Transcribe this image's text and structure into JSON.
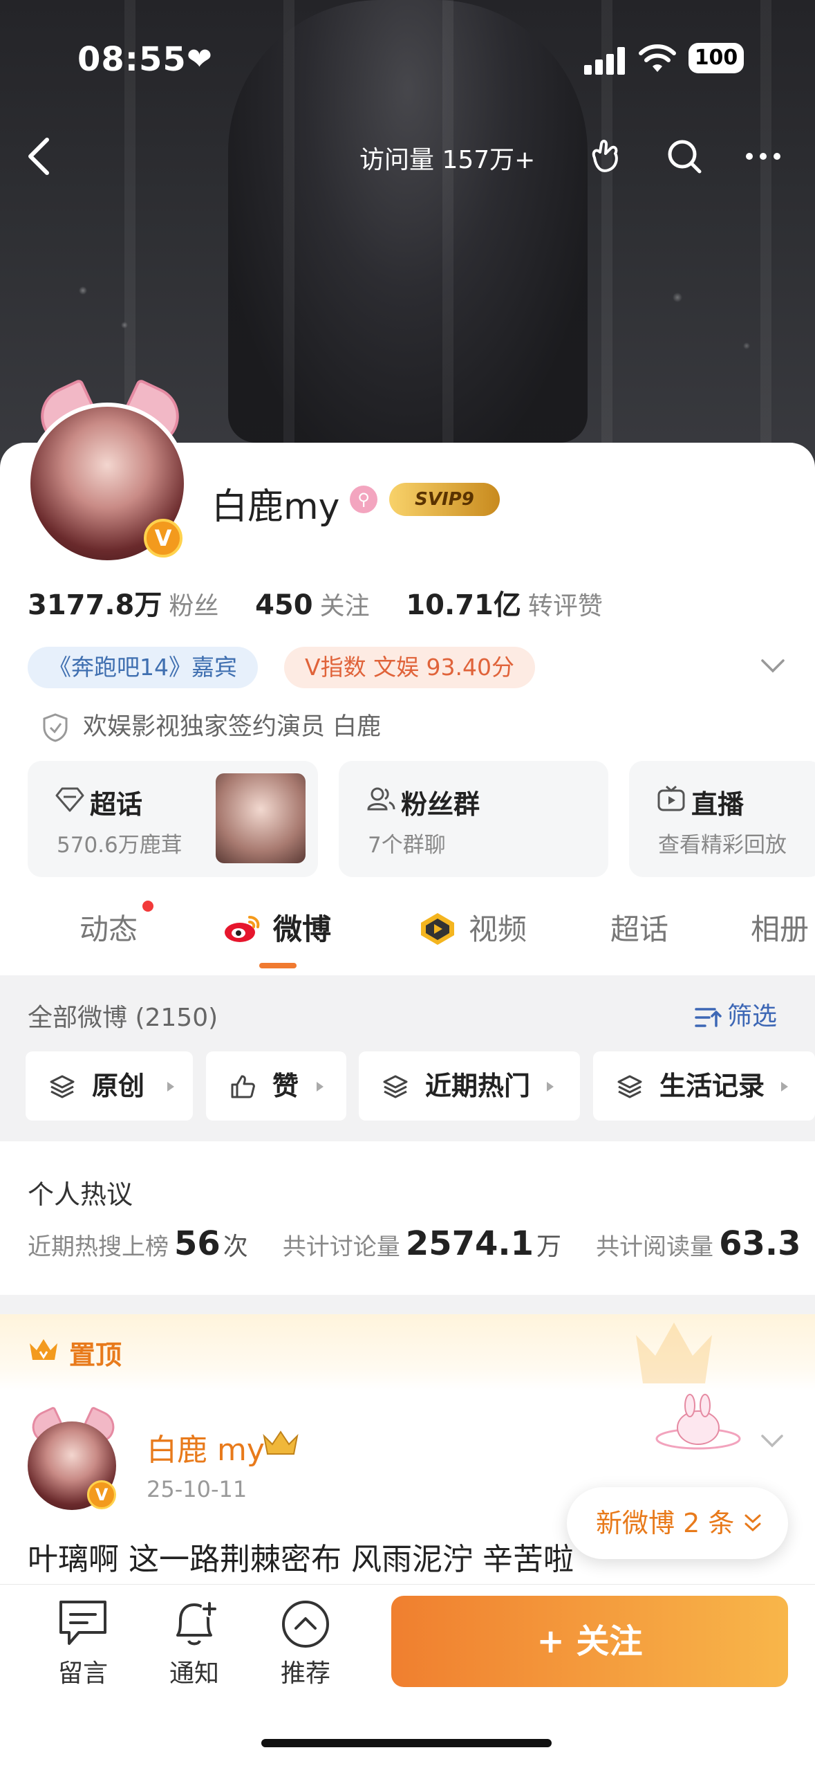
{
  "status_bar": {
    "time": "08:55",
    "battery": "100"
  },
  "nav": {
    "visits": "访问量 157万+"
  },
  "profile": {
    "name": "白鹿my",
    "svip": "SVIP9",
    "stats": [
      {
        "value": "3177.8万",
        "label": "粉丝"
      },
      {
        "value": "450",
        "label": "关注"
      },
      {
        "value": "10.71亿",
        "label": "转评赞"
      }
    ],
    "tags": [
      "《奔跑吧14》嘉宾",
      "V指数 文娱 93.40分"
    ],
    "verification": "欢娱影视独家签约演员 白鹿"
  },
  "features": [
    {
      "title": "超话",
      "sub": "570.6万鹿茸"
    },
    {
      "title": "粉丝群",
      "sub": "7个群聊"
    },
    {
      "title": "直播",
      "sub": "查看精彩回放"
    }
  ],
  "tabs": [
    "动态",
    "微博",
    "视频",
    "超话",
    "相册"
  ],
  "feed_header": {
    "all": "全部微博 (2150)",
    "filter": "筛选"
  },
  "chips": [
    "原创",
    "赞",
    "近期热门",
    "生活记录"
  ],
  "hot": {
    "title": "个人热议",
    "items": [
      {
        "label": "近期热搜上榜",
        "value": "56",
        "unit": "次"
      },
      {
        "label": "共计讨论量",
        "value": "2574.1",
        "unit": "万"
      },
      {
        "label": "共计阅读量",
        "value": "63.3",
        "unit": ""
      }
    ]
  },
  "pinned": {
    "label": "置顶"
  },
  "post": {
    "author": "白鹿 my",
    "date": "25-10-11",
    "text": "叶璃啊 这一路荆棘密布 风雨泥泞 辛苦啦"
  },
  "new_posts": "新微博 2 条",
  "bottom_bar": {
    "items": [
      "留言",
      "通知",
      "推荐"
    ],
    "follow": "+ 关注"
  },
  "colors": {
    "accent": "#f07f2f",
    "link": "#3d67b5",
    "tag_blue_bg": "#e7f0fb",
    "tag_orange_bg": "#fdebe3"
  }
}
